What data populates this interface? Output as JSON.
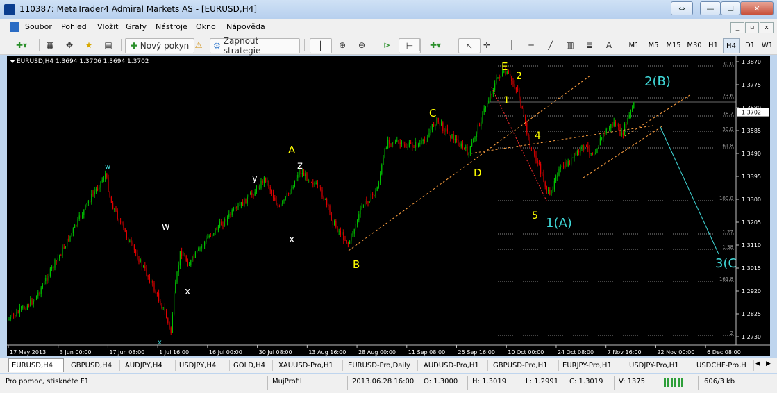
{
  "window": {
    "title": "110387: MetaTrader4 Admiral Markets AS - [EURUSD,H4]",
    "minimize": "—",
    "maximize": "☐",
    "close": "✕",
    "restore": "⇔"
  },
  "menu": {
    "items": [
      "Soubor",
      "Pohled",
      "Vložit",
      "Grafy",
      "Nástroje",
      "Okno",
      "Nápověda"
    ],
    "mdi": [
      "_",
      "▫",
      "x"
    ]
  },
  "toolbar": {
    "new_order": "Nový pokyn",
    "autotrading": "Zapnout strategie",
    "periods": [
      "M1",
      "M5",
      "M15",
      "M30",
      "H1",
      "H4",
      "D1",
      "W1"
    ],
    "active_period": "H4",
    "text_tool": "A"
  },
  "chart": {
    "header": "EURUSD,H4  1.3694 1.3706 1.3694 1.3702",
    "last_price": "1.3702",
    "price_labels": [
      "1.3870",
      "1.3775",
      "1.3680",
      "1.3585",
      "1.3490",
      "1.3395",
      "1.3300",
      "1.3205",
      "1.3110",
      "1.3015",
      "1.2920",
      "1.2825",
      "1.2730"
    ],
    "date_labels": [
      "17 May 2013",
      "3 Jun 00:00",
      "17 Jun 08:00",
      "1 Jul 16:00",
      "16 Jul 00:00",
      "30 Jul 08:00",
      "13 Aug 16:00",
      "28 Aug 00:00",
      "11 Sep 08:00",
      "25 Sep 16:00",
      "10 Oct 00:00",
      "24 Oct 08:00",
      "7 Nov 16:00",
      "22 Nov 00:00",
      "6 Dec 08:00"
    ],
    "fib_levels": [
      "30.0",
      "23.6",
      "38.2",
      "50.0",
      "61.8",
      "100.0",
      "1.27",
      "1.38",
      "161.8",
      "2"
    ],
    "wave_labels": {
      "w1": "w",
      "x1": "x",
      "w2": "w",
      "x2": "x",
      "y": "y",
      "x3": "x",
      "A": "A",
      "z": "z",
      "B": "B",
      "C": "C",
      "D": "D",
      "E": "E",
      "n1": "1",
      "n2": "2",
      "n4": "4",
      "n5": "5",
      "wA": "1(A)",
      "wB": "2(B)",
      "wC": "3(C"
    }
  },
  "tabs": [
    "EURUSD,H4",
    "GBPUSD,H4",
    "AUDJPY,H4",
    "USDJPY,H4",
    "GOLD,H4",
    "XAUUSD-Pro,H1",
    "EURUSD-Pro,Daily",
    "AUDUSD-Pro,H1",
    "GBPUSD-Pro,H1",
    "EURJPY-Pro,H1",
    "USDJPY-Pro,H1",
    "USDCHF-Pro,H"
  ],
  "status": {
    "help": "Pro pomoc, stiskněte F1",
    "profile": "MujProfil",
    "datetime": "2013.06.28 16:00",
    "open": "O: 1.3000",
    "high": "H: 1.3019",
    "low": "L: 1.2991",
    "close": "C: 1.3019",
    "volume": "V: 1375",
    "traffic": "606/3 kb"
  },
  "colors": {
    "bull": "#00c000",
    "bear": "#e00000",
    "label_yellow": "#ffff00",
    "label_cyan": "#40d8d8",
    "label_white": "#ffffff",
    "trend_orange": "#ffa040"
  }
}
